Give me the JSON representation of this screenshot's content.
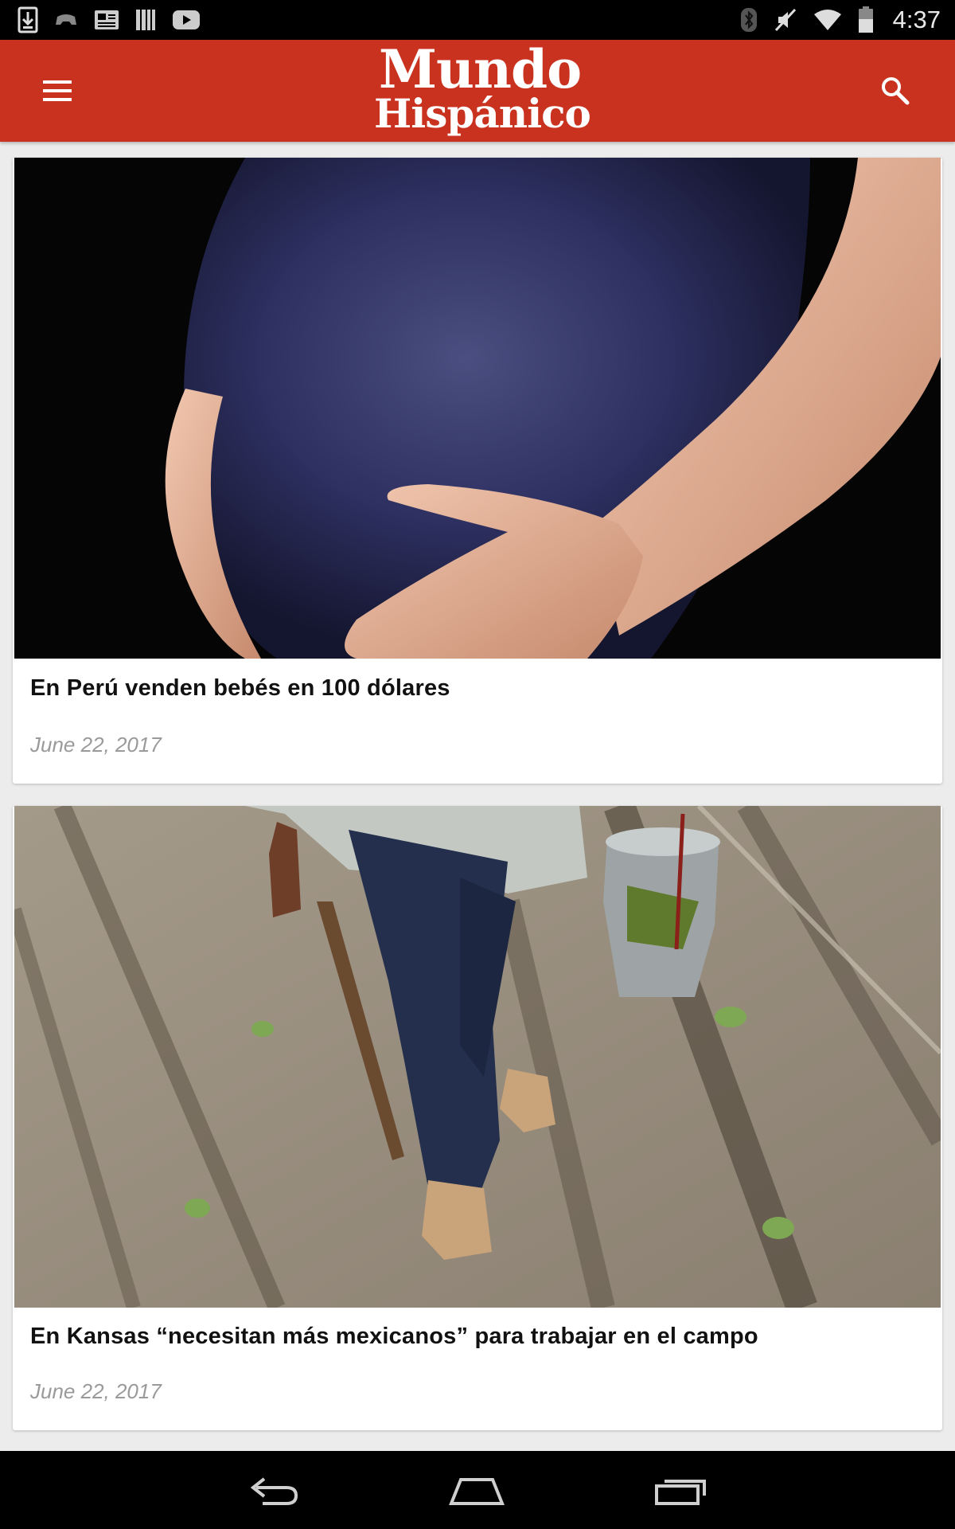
{
  "status_bar": {
    "time": "4:37",
    "left_icons": [
      "download-icon",
      "game-controller-icon",
      "news-icon",
      "library-icon",
      "youtube-icon"
    ],
    "right_icons": [
      "bluetooth-icon",
      "muted-icon",
      "wifi-icon",
      "battery-icon"
    ]
  },
  "app_bar": {
    "brand_line1": "Mundo",
    "brand_line2": "Hispánico",
    "background_color": "#c8321f",
    "menu_icon": "hamburger-menu-icon",
    "search_icon": "search-icon"
  },
  "articles": [
    {
      "title": "En Perú venden bebés en 100 dólares",
      "date": "June 22, 2017",
      "image": "pregnant-belly-photo"
    },
    {
      "title": "En Kansas “necesitan más mexicanos” para trabajar en el campo",
      "date": "June 22, 2017",
      "image": "farm-worker-field-photo"
    }
  ],
  "nav_bar": {
    "buttons": [
      "back-icon",
      "home-icon",
      "recent-apps-icon"
    ]
  }
}
